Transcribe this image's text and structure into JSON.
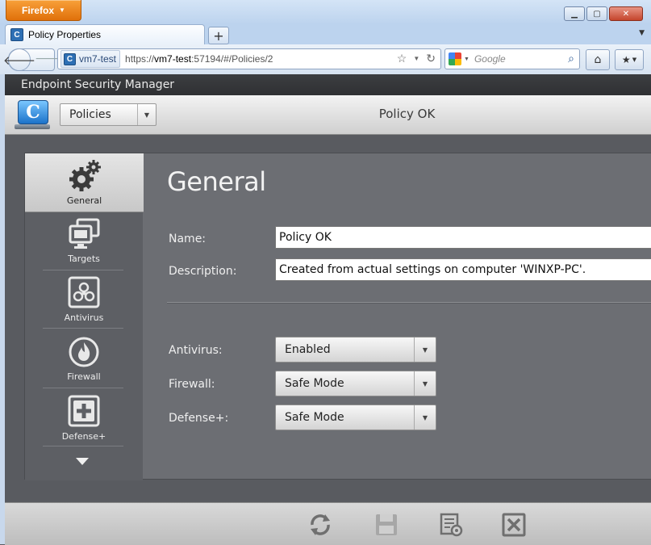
{
  "browser": {
    "menu_button": "Firefox",
    "tab_title": "Policy Properties",
    "site_identity": "vm7-test",
    "url_scheme": "https://",
    "url_host": "vm7-test",
    "url_rest": ":57194/#/Policies/2",
    "search_placeholder": "Google"
  },
  "app": {
    "name": "Endpoint Security Manager",
    "module_select": "Policies",
    "policy_title": "Policy OK"
  },
  "sidebar": {
    "items": [
      {
        "label": "General",
        "icon": "gears-icon",
        "active": true
      },
      {
        "label": "Targets",
        "icon": "monitors-icon",
        "active": false
      },
      {
        "label": "Antivirus",
        "icon": "biohazard-icon",
        "active": false
      },
      {
        "label": "Firewall",
        "icon": "flame-icon",
        "active": false
      },
      {
        "label": "Defense+",
        "icon": "plus-icon",
        "active": false
      }
    ]
  },
  "main": {
    "title": "General",
    "name_label": "Name:",
    "name_value": "Policy OK",
    "description_label": "Description:",
    "description_value": "Created from actual settings on computer 'WINXP-PC'.",
    "antivirus_label": "Antivirus:",
    "antivirus_value": "Enabled",
    "firewall_label": "Firewall:",
    "firewall_value": "Safe Mode",
    "defense_label": "Defense+:",
    "defense_value": "Safe Mode"
  },
  "colors": {
    "header_bg": "#333538",
    "panel_bg": "#6c6e73",
    "firefox_orange": "#e8800f"
  }
}
